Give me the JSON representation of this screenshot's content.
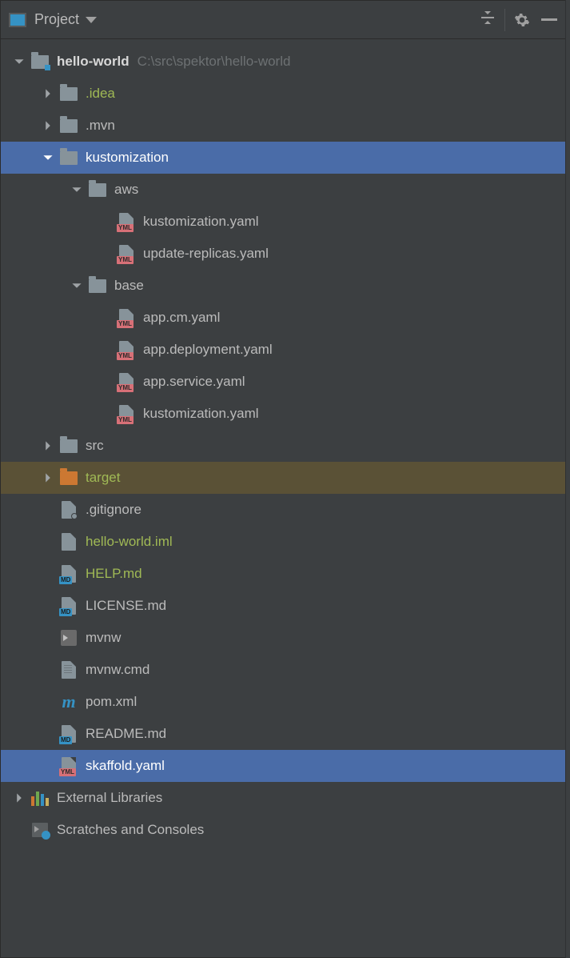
{
  "toolbar": {
    "title": "Project"
  },
  "tree": {
    "root": {
      "name": "hello-world",
      "path": "C:\\src\\spektor\\hello-world"
    },
    "items": {
      "idea": ".idea",
      "mvn": ".mvn",
      "kustomization": "kustomization",
      "aws": "aws",
      "aws_kustomization": "kustomization.yaml",
      "aws_replicas": "update-replicas.yaml",
      "base": "base",
      "base_app_cm": "app.cm.yaml",
      "base_app_deploy": "app.deployment.yaml",
      "base_app_svc": "app.service.yaml",
      "base_kustomization": "kustomization.yaml",
      "src": "src",
      "target": "target",
      "gitignore": ".gitignore",
      "iml": "hello-world.iml",
      "help": "HELP.md",
      "license": "LICENSE.md",
      "mvnw": "mvnw",
      "mvnw_cmd": "mvnw.cmd",
      "pom": "pom.xml",
      "readme": "README.md",
      "skaffold": "skaffold.yaml"
    },
    "external": "External Libraries",
    "scratches": "Scratches and Consoles"
  }
}
